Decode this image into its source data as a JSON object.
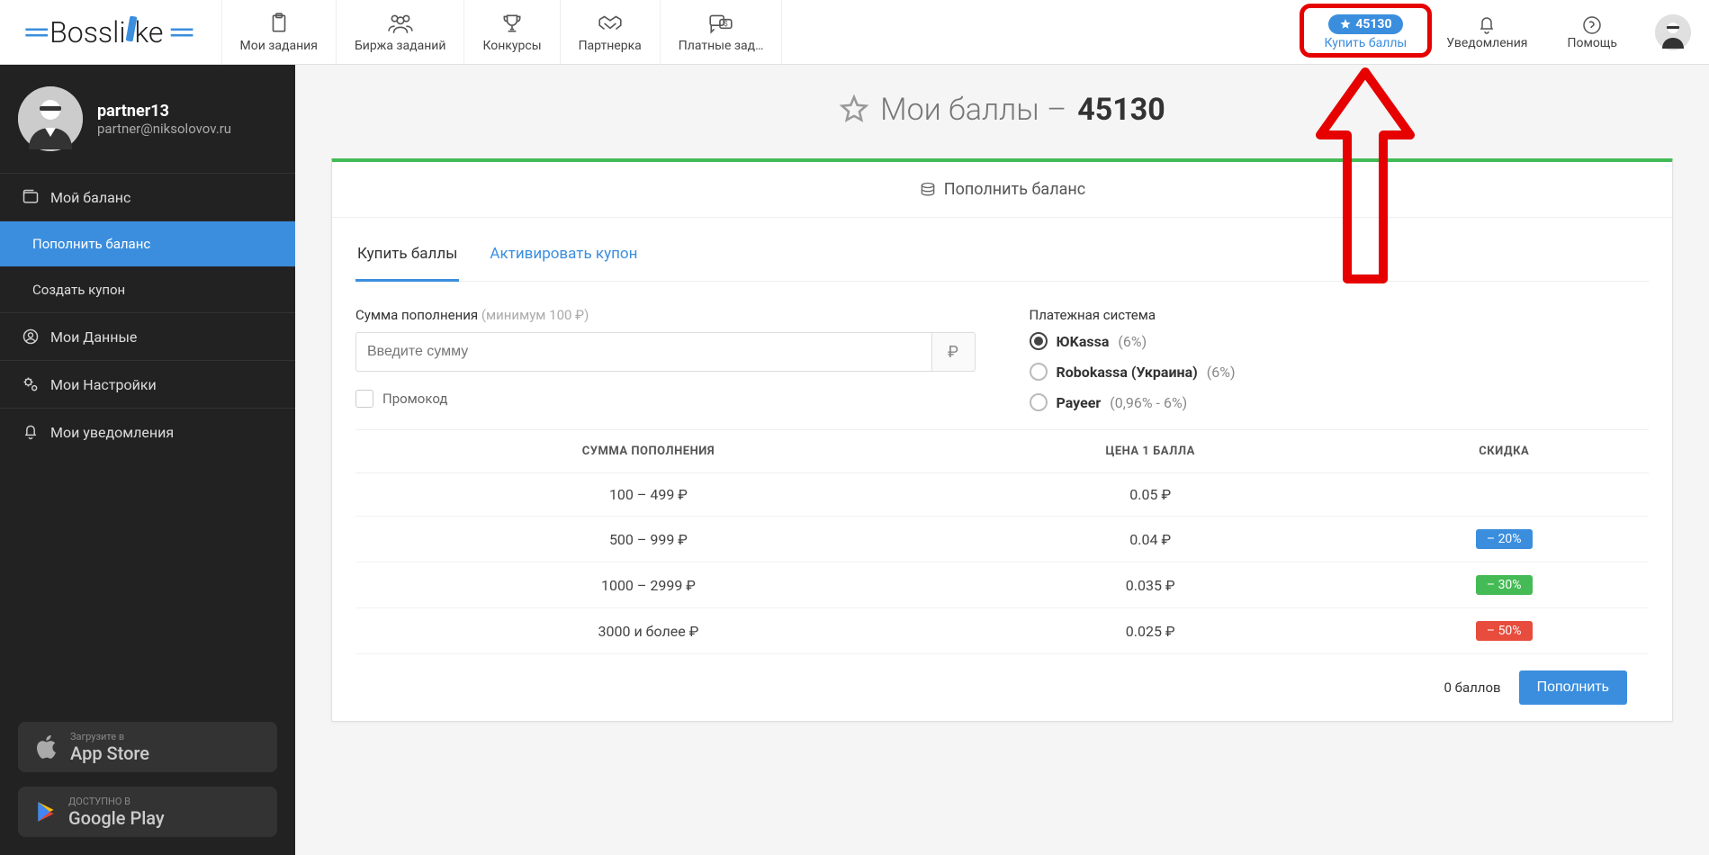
{
  "logo": "Bossl",
  "logo_rest": "ke",
  "nav": [
    {
      "label": "Мои задания"
    },
    {
      "label": "Биржа заданий"
    },
    {
      "label": "Конкурсы"
    },
    {
      "label": "Партнерка"
    },
    {
      "label": "Платные зад…"
    }
  ],
  "header": {
    "points": "45130",
    "buy_label": "Купить баллы",
    "notifications": "Уведомления",
    "help": "Помощь"
  },
  "user": {
    "name": "partner13",
    "email": "partner@niksolovov.ru"
  },
  "sidebar": {
    "items": [
      {
        "label": "Мой баланс"
      },
      {
        "label": "Пополнить баланс"
      },
      {
        "label": "Создать купон"
      },
      {
        "label": "Мои Данные"
      },
      {
        "label": "Мои Настройки"
      },
      {
        "label": "Мои уведомления"
      }
    ],
    "appstore_small": "Загрузите в",
    "appstore_big": "App Store",
    "gplay_small": "ДОСТУПНО В",
    "gplay_big": "Google Play"
  },
  "page": {
    "title_prefix": "Мои баллы –",
    "title_value": "45130",
    "card_header": "Пополнить баланс",
    "tabs": [
      "Купить баллы",
      "Активировать купон"
    ],
    "amount_label": "Сумма пополнения ",
    "amount_hint": "(минимум 100 ₽)",
    "amount_placeholder": "Введите сумму",
    "currency": "₽",
    "promo": "Промокод",
    "pay_system_label": "Платежная система",
    "pay_options": [
      {
        "name": "ЮKassa",
        "fee": "(6%)"
      },
      {
        "name": "Robokassa (Украина)",
        "fee": "(6%)"
      },
      {
        "name": "Payeer",
        "fee": "(0,96% - 6%)"
      }
    ],
    "table": {
      "headers": [
        "СУММА ПОПОЛНЕНИЯ",
        "ЦЕНА 1 БАЛЛА",
        "СКИДКА"
      ],
      "rows": [
        {
          "amount": "100 – 499 ₽",
          "price": "0.05 ₽",
          "discount": ""
        },
        {
          "amount": "500 – 999 ₽",
          "price": "0.04 ₽",
          "discount": "– 20%",
          "class": "d20"
        },
        {
          "amount": "1000 – 2999 ₽",
          "price": "0.035 ₽",
          "discount": "– 30%",
          "class": "d30"
        },
        {
          "amount": "3000 и более ₽",
          "price": "0.025 ₽",
          "discount": "– 50%",
          "class": "d50"
        }
      ]
    },
    "footer_text": "0 баллов",
    "submit": "Пополнить"
  }
}
